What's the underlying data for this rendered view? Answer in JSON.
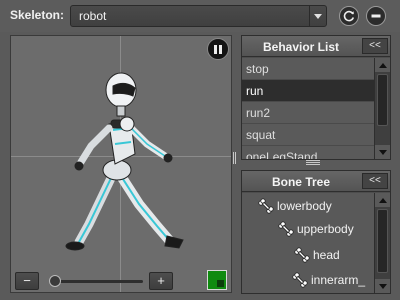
{
  "skeleton": {
    "label": "Skeleton:",
    "selected": "robot"
  },
  "behavior_panel": {
    "title": "Behavior List",
    "collapse_label": "<<",
    "items": [
      "stop",
      "run",
      "run2",
      "squat",
      "oneLegStand"
    ],
    "selected_index": 1
  },
  "bone_panel": {
    "title": "Bone Tree",
    "collapse_label": "<<",
    "items": [
      "lowerbody",
      "upperbody",
      "head",
      "innerarm_"
    ]
  },
  "viewport": {
    "zoom_minus": "−",
    "zoom_plus": "+"
  },
  "colors": {
    "accent_cyan": "#39c7d6",
    "selected_row": "#2d2d2d",
    "green_toggle": "#0f8a0f"
  },
  "icons": [
    "refresh-icon",
    "stop-circle-icon",
    "pause-icon",
    "bone-icon"
  ]
}
